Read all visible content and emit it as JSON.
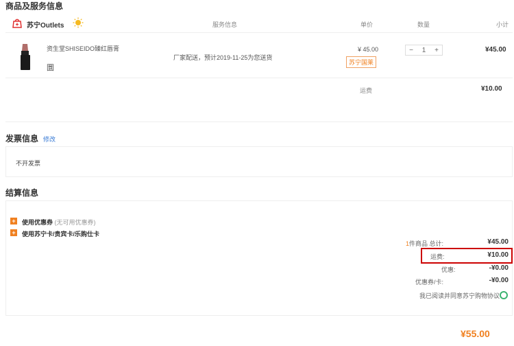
{
  "sections": {
    "goods_title": "商品及服务信息",
    "invoice_title": "发票信息",
    "settle_title": "结算信息"
  },
  "goods": {
    "store_name": "苏宁Outlets",
    "columns": {
      "service": "服务信息",
      "unit_price": "单价",
      "quantity": "数量",
      "subtotal": "小计"
    },
    "item": {
      "name": "资生堂SHISEIDO臻红唇膏",
      "gift": "圜",
      "service": "厂家配送，预计2019-11-25为您送货",
      "unit_price": "¥ 45.00",
      "badge": "苏宁国莱",
      "quantity": "1",
      "minus": "−",
      "plus": "+",
      "subtotal": "¥45.00"
    },
    "freight_label": "运费",
    "freight_value": "¥10.00"
  },
  "invoice": {
    "edit": "修改",
    "value": "不开发票"
  },
  "settle": {
    "coupon_label": "使用优惠券",
    "coupon_note": "(无可用优惠券)",
    "card_label": "使用苏宁卡/贵宾卡/乐购仕卡",
    "item_count": "1",
    "item_count_suffix": "件商品 总计:",
    "total_goods": "¥45.00",
    "freight_label": "运费:",
    "freight_value": "¥10.00",
    "discount_label": "优惠:",
    "discount_value": "-¥0.00",
    "coupon_card_label": "优惠券/卡:",
    "coupon_card_value": "-¥0.00",
    "agree_text": "我已阅读并同意苏宁购物协议",
    "total": "¥55.00"
  },
  "colors": {
    "accent": "#f08020",
    "highlight": "#cc0000",
    "link": "#3a7bd5"
  }
}
